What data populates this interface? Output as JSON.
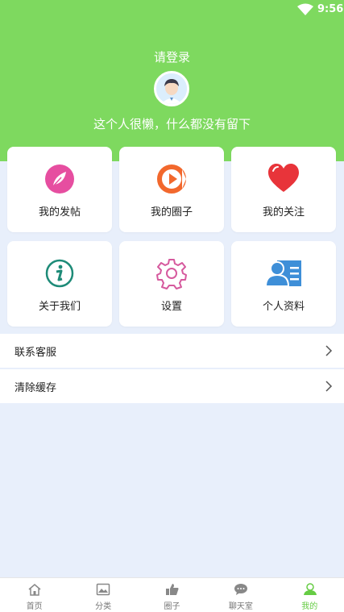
{
  "status": {
    "time": "9:56",
    "wifi_icon": "wifi-icon"
  },
  "profile": {
    "login_text": "请登录",
    "motto": "这个人很懒，什么都没有留下",
    "avatar_icon": "avatar-icon"
  },
  "grid": [
    {
      "label": "我的发帖",
      "icon": "feather-icon",
      "color": "#e64ea0"
    },
    {
      "label": "我的圈子",
      "icon": "play-circle-icon",
      "color": "#f2682d"
    },
    {
      "label": "我的关注",
      "icon": "heart-icon",
      "color": "#e8343a"
    },
    {
      "label": "关于我们",
      "icon": "info-icon",
      "color": "#1e8b78"
    },
    {
      "label": "设置",
      "icon": "gear-icon",
      "color": "#d65a9e"
    },
    {
      "label": "个人资料",
      "icon": "profile-card-icon",
      "color": "#3e8fd8"
    }
  ],
  "list": [
    {
      "label": "联系客服"
    },
    {
      "label": "清除缓存"
    }
  ],
  "tabs": [
    {
      "label": "首页",
      "icon": "home-icon",
      "active": false
    },
    {
      "label": "分类",
      "icon": "category-icon",
      "active": false
    },
    {
      "label": "圈子",
      "icon": "thumb-icon",
      "active": false
    },
    {
      "label": "聊天室",
      "icon": "chat-icon",
      "active": false
    },
    {
      "label": "我的",
      "icon": "user-icon",
      "active": true
    }
  ],
  "colors": {
    "header": "#7ed95f",
    "background": "#e8effb",
    "active_tab": "#66cc44"
  }
}
